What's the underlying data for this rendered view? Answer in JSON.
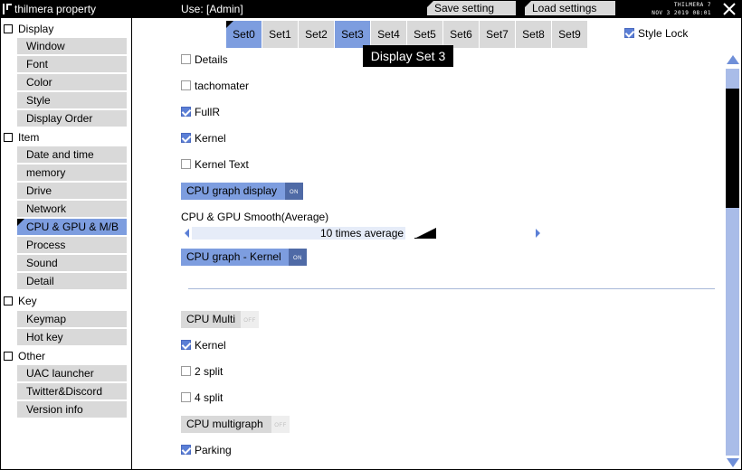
{
  "titlebar": {
    "app_title": "thilmera property",
    "user": "Use: [Admin]",
    "save_label": "Save setting",
    "load_label": "Load settings",
    "clock_line1": "THILMERA 7",
    "clock_line2": "NOV 3 2019 08:01"
  },
  "sidebar": {
    "sections": [
      {
        "label": "Display",
        "items": [
          "Window",
          "Font",
          "Color",
          "Style",
          "Display Order"
        ]
      },
      {
        "label": "Item",
        "items": [
          "Date and time",
          "memory",
          "Drive",
          "Network",
          "CPU & GPU & M/B",
          "Process",
          "Sound",
          "Detail"
        ]
      },
      {
        "label": "Key",
        "items": [
          "Keymap",
          "Hot key"
        ]
      },
      {
        "label": "Other",
        "items": [
          "UAC launcher",
          "Twitter&Discord",
          "Version info"
        ]
      }
    ],
    "active_item": "CPU & GPU & M/B"
  },
  "sets": {
    "tabs": [
      "Set0",
      "Set1",
      "Set2",
      "Set3",
      "Set4",
      "Set5",
      "Set6",
      "Set7",
      "Set8",
      "Set9"
    ],
    "selected": [
      "Set0",
      "Set3"
    ],
    "tooltip": "Display Set 3"
  },
  "style_lock": {
    "label": "Style Lock",
    "checked": true
  },
  "options": {
    "details": {
      "label": "Details",
      "checked": false
    },
    "tachometer": {
      "label": "tachomater",
      "checked": false
    },
    "fullr": {
      "label": "FullR",
      "checked": true
    },
    "kernel": {
      "label": "Kernel",
      "checked": true
    },
    "kernel_text": {
      "label": "Kernel Text",
      "checked": false
    },
    "cpu_graph_display": {
      "label": "CPU graph display",
      "state": "ON"
    },
    "smooth": {
      "label": "CPU & GPU Smooth(Average)",
      "value": "10 times average"
    },
    "cpu_graph_kernel": {
      "label": "CPU graph - Kernel",
      "state": "ON"
    },
    "cpu_multi": {
      "label": "CPU Multi",
      "state": "OFF"
    },
    "multi_kernel": {
      "label": "Kernel",
      "checked": true
    },
    "split2": {
      "label": "2 split",
      "checked": false
    },
    "split4": {
      "label": "4 split",
      "checked": false
    },
    "cpu_multigraph": {
      "label": "CPU multigraph",
      "state": "OFF"
    },
    "parking": {
      "label": "Parking",
      "checked": true
    }
  },
  "colors": {
    "accent": "#7d9ddf",
    "toggle_on": "#4f6aa6",
    "button_gray": "#d9d9d9",
    "scroll_track": "#a9bce8"
  }
}
